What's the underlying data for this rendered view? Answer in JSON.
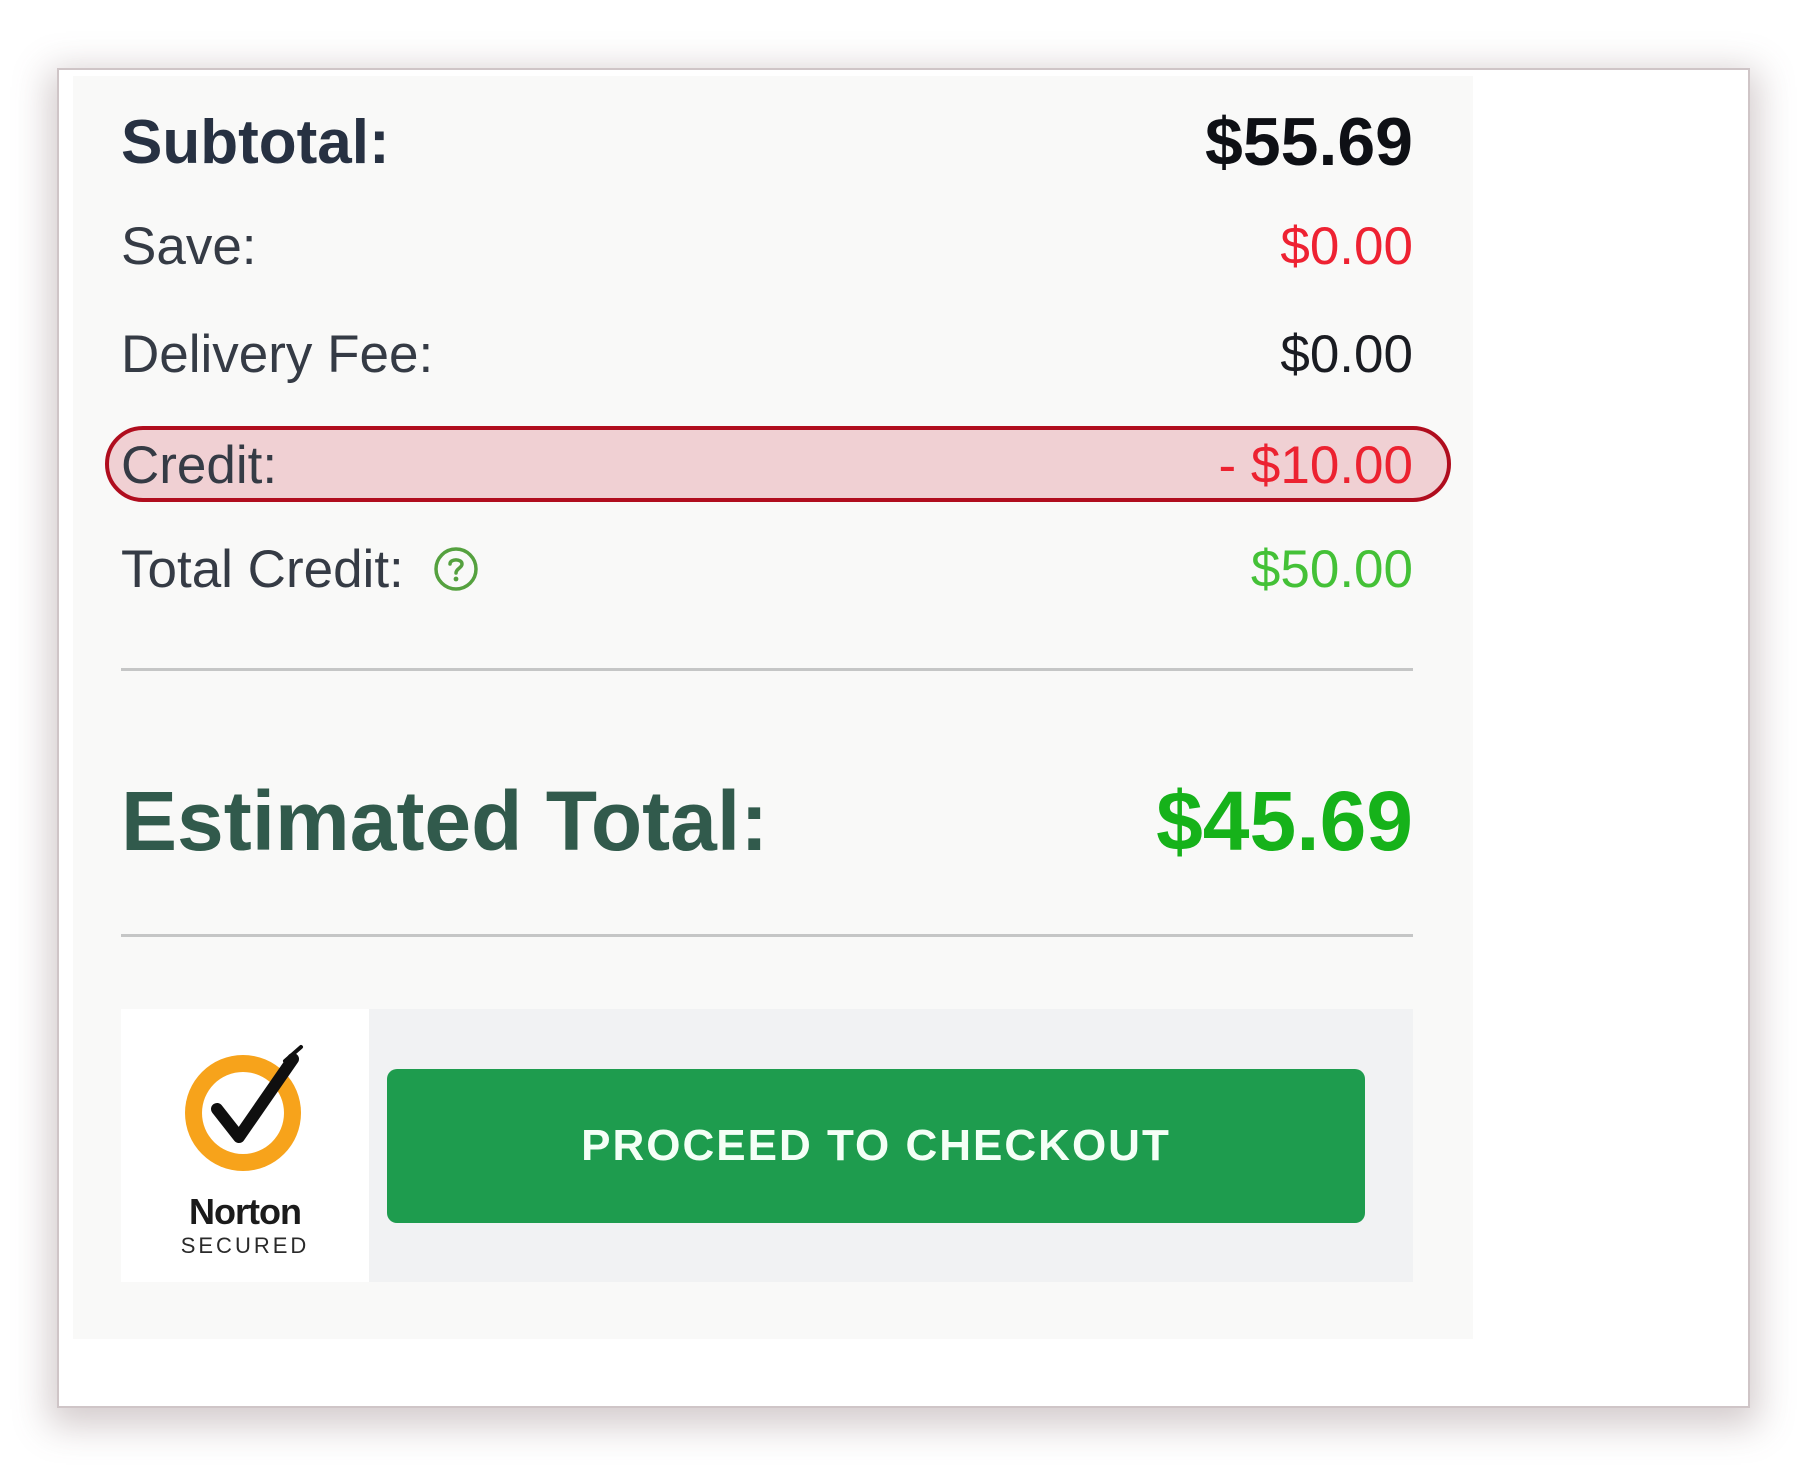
{
  "summary": {
    "subtotal": {
      "label": "Subtotal:",
      "value": "$55.69"
    },
    "save": {
      "label": "Save:",
      "value": "$0.00"
    },
    "delivery_fee": {
      "label": "Delivery Fee:",
      "value": "$0.00"
    },
    "credit": {
      "label": "Credit:",
      "value": "- $10.00"
    },
    "total_credit": {
      "label": "Total Credit:",
      "value": "$50.00",
      "help_icon": "question-circle-icon"
    },
    "estimated_total": {
      "label": "Estimated Total:",
      "value": "$45.69"
    }
  },
  "checkout": {
    "button_label": "PROCEED TO CHECKOUT",
    "badge": {
      "name": "Norton",
      "subtitle": "SECURED",
      "icon": "norton-checkmark-icon"
    }
  },
  "colors": {
    "discount": "#ee2232",
    "positive": "#44c137",
    "total": "#16b21a",
    "button": "#1e9c4e",
    "highlight_border": "#b00d1e"
  }
}
